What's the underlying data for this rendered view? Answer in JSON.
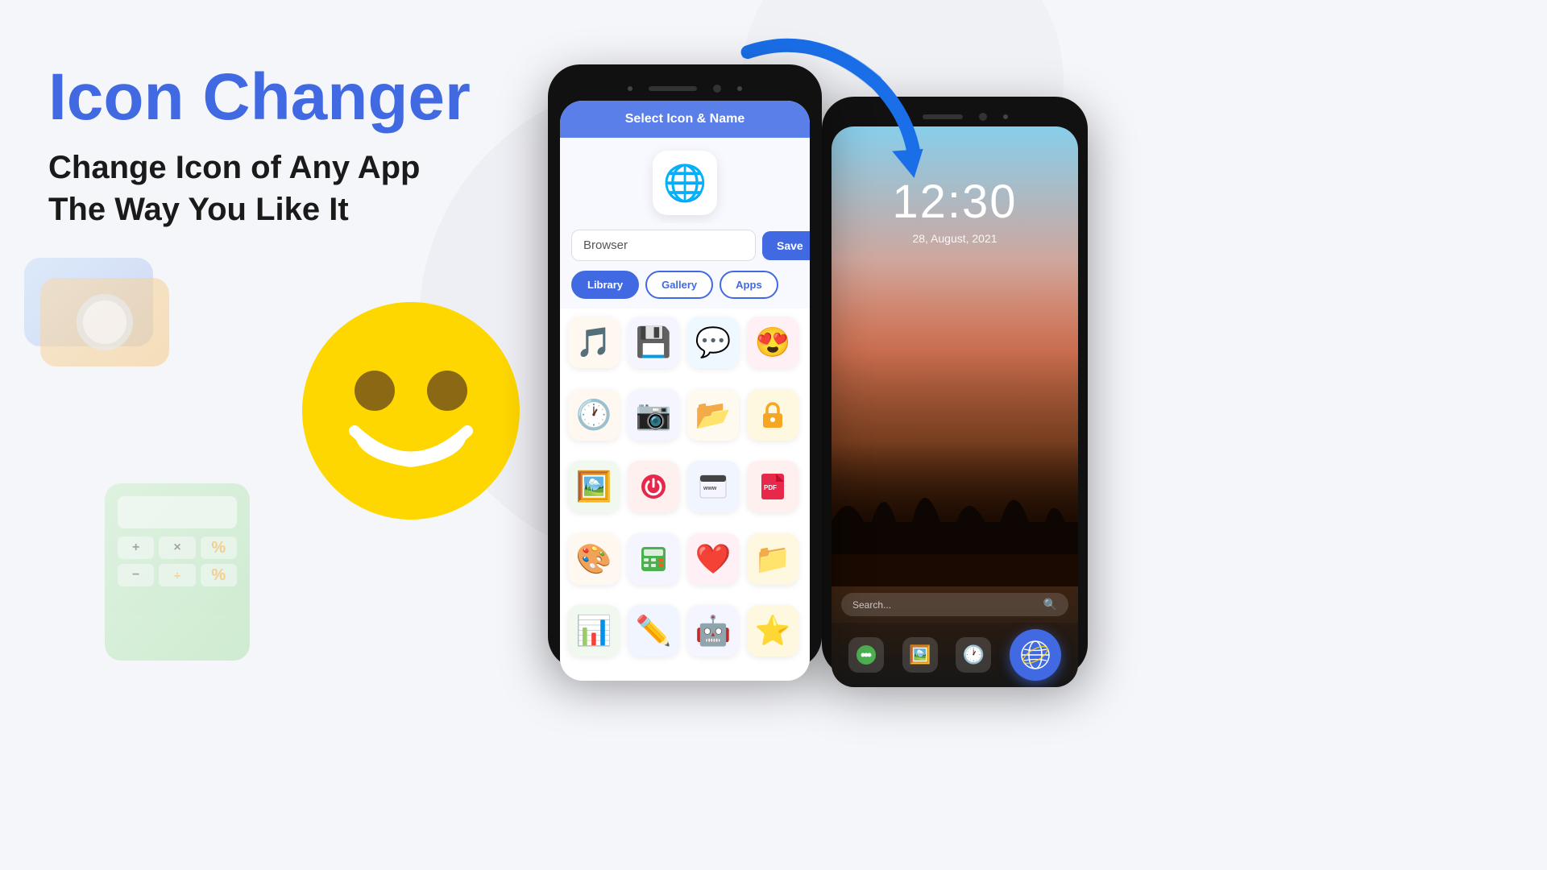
{
  "app": {
    "title": "Icon Changer",
    "subtitle_line1": "Change Icon of Any App",
    "subtitle_line2": "The Way You Like It"
  },
  "phone1": {
    "header": "Select Icon & Name",
    "current_icon": "🌐",
    "name_input_value": "Browser",
    "name_input_placeholder": "Browser",
    "save_button": "Save",
    "tabs": [
      {
        "label": "Library",
        "active": true
      },
      {
        "label": "Gallery",
        "active": false
      },
      {
        "label": "Apps",
        "active": false
      }
    ],
    "icons": [
      {
        "emoji": "🎵",
        "label": "music"
      },
      {
        "emoji": "💾",
        "label": "save"
      },
      {
        "emoji": "💬",
        "label": "chat"
      },
      {
        "emoji": "😍",
        "label": "love-face"
      },
      {
        "emoji": "🕐",
        "label": "clock"
      },
      {
        "emoji": "📷",
        "label": "camera"
      },
      {
        "emoji": "📂",
        "label": "folder"
      },
      {
        "emoji": "🔒",
        "label": "lock"
      },
      {
        "emoji": "🖼️",
        "label": "image"
      },
      {
        "emoji": "⭕",
        "label": "power"
      },
      {
        "emoji": "🌐",
        "label": "web"
      },
      {
        "emoji": "📄",
        "label": "pdf"
      },
      {
        "emoji": "🎨",
        "label": "palette"
      },
      {
        "emoji": "🧮",
        "label": "calculator"
      },
      {
        "emoji": "❤️",
        "label": "heart"
      },
      {
        "emoji": "📁",
        "label": "folder2"
      },
      {
        "emoji": "📊",
        "label": "chart"
      },
      {
        "emoji": "✏️",
        "label": "edit"
      },
      {
        "emoji": "🤖",
        "label": "robot"
      },
      {
        "emoji": "⭐",
        "label": "star"
      }
    ]
  },
  "phone2": {
    "time": "12:30",
    "date": "28, August, 2021",
    "search_placeholder": "Search...",
    "dock_icons": [
      {
        "emoji": "💬",
        "label": "messages"
      },
      {
        "emoji": "🖼️",
        "label": "gallery"
      },
      {
        "emoji": "🕐",
        "label": "clock"
      },
      {
        "emoji": "🌐",
        "label": "browser"
      }
    ]
  },
  "decorative": {
    "arrow_color": "#1a6fe8",
    "camera_color": "#f5a623",
    "smiley_color": "#FFD700"
  }
}
